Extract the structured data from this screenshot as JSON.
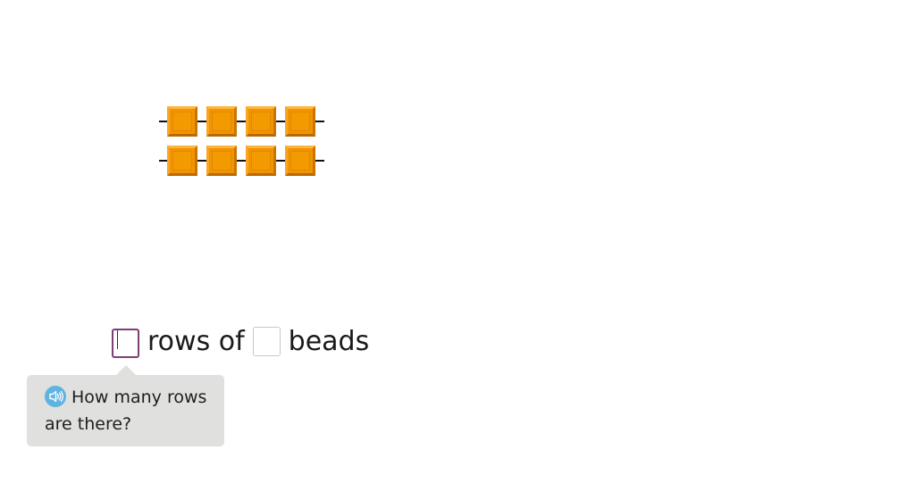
{
  "bead_array": {
    "rows": 2,
    "beads_per_row": 4,
    "bead_color": "#f29400",
    "wire_color": "#111111"
  },
  "sentence": {
    "rows_value": "",
    "rows_label": "rows of",
    "beads_value": "",
    "beads_label": "beads"
  },
  "hint": {
    "icon": "speaker-icon",
    "text": "How many rows are there?",
    "background": "#e0e0df",
    "icon_color": "#5fb3e0"
  },
  "colors": {
    "active_input_border": "#7e3f77",
    "inactive_input_border": "#c8c8c8"
  }
}
